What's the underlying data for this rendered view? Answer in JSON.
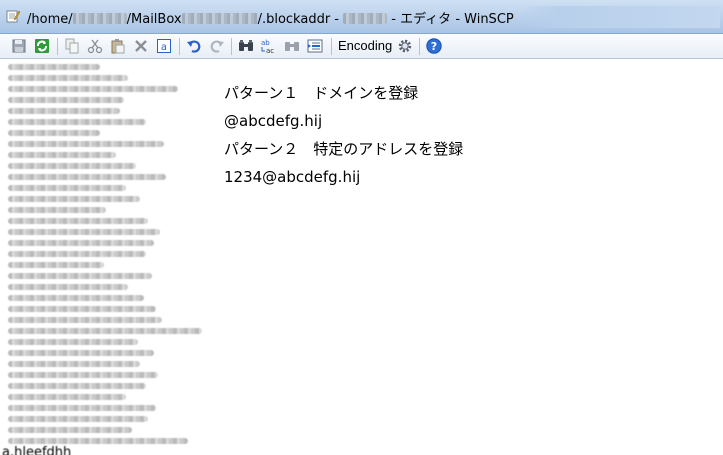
{
  "window": {
    "title_prefix": "/home/",
    "title_mid": "/MailBox",
    "title_suffix": "/.blockaddr - ",
    "title_app": " - エディタ - WinSCP"
  },
  "toolbar": {
    "buttons": [
      "save-icon",
      "refresh-icon",
      "copy-icon",
      "cut-icon",
      "paste-icon",
      "delete-icon",
      "select-all-icon",
      "undo-icon",
      "redo-icon",
      "find-icon",
      "replace-icon",
      "find-next-icon",
      "goto-line-icon",
      "settings-gear-icon",
      "help-icon"
    ],
    "encoding_label": "Encoding"
  },
  "editor": {
    "lines": [
      "パターン１　ドメインを登録",
      "@abcdefg.hij",
      "パターン２　特定のアドレスを登録",
      "1234@abcdefg.hij"
    ],
    "bottom_line": "a.hleefdhh"
  },
  "colors": {
    "titlebar": "#b9d1ea",
    "help_blue": "#2d6fd6",
    "undo_blue": "#2a62c9"
  }
}
